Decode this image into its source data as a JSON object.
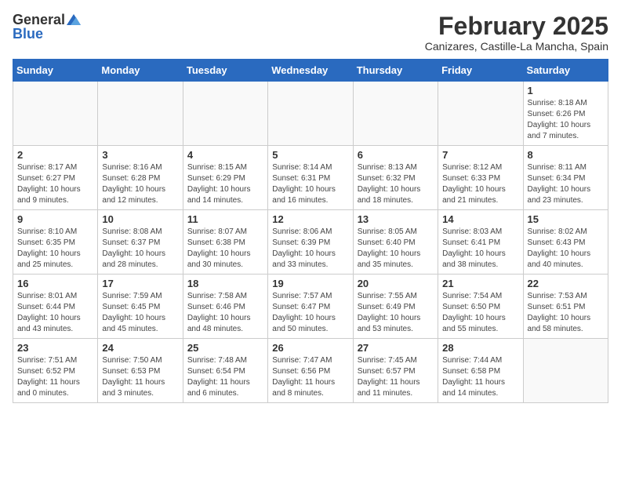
{
  "logo": {
    "general": "General",
    "blue": "Blue"
  },
  "title": "February 2025",
  "subtitle": "Canizares, Castille-La Mancha, Spain",
  "days_of_week": [
    "Sunday",
    "Monday",
    "Tuesday",
    "Wednesday",
    "Thursday",
    "Friday",
    "Saturday"
  ],
  "weeks": [
    [
      {
        "day": "",
        "info": ""
      },
      {
        "day": "",
        "info": ""
      },
      {
        "day": "",
        "info": ""
      },
      {
        "day": "",
        "info": ""
      },
      {
        "day": "",
        "info": ""
      },
      {
        "day": "",
        "info": ""
      },
      {
        "day": "1",
        "info": "Sunrise: 8:18 AM\nSunset: 6:26 PM\nDaylight: 10 hours\nand 7 minutes."
      }
    ],
    [
      {
        "day": "2",
        "info": "Sunrise: 8:17 AM\nSunset: 6:27 PM\nDaylight: 10 hours\nand 9 minutes."
      },
      {
        "day": "3",
        "info": "Sunrise: 8:16 AM\nSunset: 6:28 PM\nDaylight: 10 hours\nand 12 minutes."
      },
      {
        "day": "4",
        "info": "Sunrise: 8:15 AM\nSunset: 6:29 PM\nDaylight: 10 hours\nand 14 minutes."
      },
      {
        "day": "5",
        "info": "Sunrise: 8:14 AM\nSunset: 6:31 PM\nDaylight: 10 hours\nand 16 minutes."
      },
      {
        "day": "6",
        "info": "Sunrise: 8:13 AM\nSunset: 6:32 PM\nDaylight: 10 hours\nand 18 minutes."
      },
      {
        "day": "7",
        "info": "Sunrise: 8:12 AM\nSunset: 6:33 PM\nDaylight: 10 hours\nand 21 minutes."
      },
      {
        "day": "8",
        "info": "Sunrise: 8:11 AM\nSunset: 6:34 PM\nDaylight: 10 hours\nand 23 minutes."
      }
    ],
    [
      {
        "day": "9",
        "info": "Sunrise: 8:10 AM\nSunset: 6:35 PM\nDaylight: 10 hours\nand 25 minutes."
      },
      {
        "day": "10",
        "info": "Sunrise: 8:08 AM\nSunset: 6:37 PM\nDaylight: 10 hours\nand 28 minutes."
      },
      {
        "day": "11",
        "info": "Sunrise: 8:07 AM\nSunset: 6:38 PM\nDaylight: 10 hours\nand 30 minutes."
      },
      {
        "day": "12",
        "info": "Sunrise: 8:06 AM\nSunset: 6:39 PM\nDaylight: 10 hours\nand 33 minutes."
      },
      {
        "day": "13",
        "info": "Sunrise: 8:05 AM\nSunset: 6:40 PM\nDaylight: 10 hours\nand 35 minutes."
      },
      {
        "day": "14",
        "info": "Sunrise: 8:03 AM\nSunset: 6:41 PM\nDaylight: 10 hours\nand 38 minutes."
      },
      {
        "day": "15",
        "info": "Sunrise: 8:02 AM\nSunset: 6:43 PM\nDaylight: 10 hours\nand 40 minutes."
      }
    ],
    [
      {
        "day": "16",
        "info": "Sunrise: 8:01 AM\nSunset: 6:44 PM\nDaylight: 10 hours\nand 43 minutes."
      },
      {
        "day": "17",
        "info": "Sunrise: 7:59 AM\nSunset: 6:45 PM\nDaylight: 10 hours\nand 45 minutes."
      },
      {
        "day": "18",
        "info": "Sunrise: 7:58 AM\nSunset: 6:46 PM\nDaylight: 10 hours\nand 48 minutes."
      },
      {
        "day": "19",
        "info": "Sunrise: 7:57 AM\nSunset: 6:47 PM\nDaylight: 10 hours\nand 50 minutes."
      },
      {
        "day": "20",
        "info": "Sunrise: 7:55 AM\nSunset: 6:49 PM\nDaylight: 10 hours\nand 53 minutes."
      },
      {
        "day": "21",
        "info": "Sunrise: 7:54 AM\nSunset: 6:50 PM\nDaylight: 10 hours\nand 55 minutes."
      },
      {
        "day": "22",
        "info": "Sunrise: 7:53 AM\nSunset: 6:51 PM\nDaylight: 10 hours\nand 58 minutes."
      }
    ],
    [
      {
        "day": "23",
        "info": "Sunrise: 7:51 AM\nSunset: 6:52 PM\nDaylight: 11 hours\nand 0 minutes."
      },
      {
        "day": "24",
        "info": "Sunrise: 7:50 AM\nSunset: 6:53 PM\nDaylight: 11 hours\nand 3 minutes."
      },
      {
        "day": "25",
        "info": "Sunrise: 7:48 AM\nSunset: 6:54 PM\nDaylight: 11 hours\nand 6 minutes."
      },
      {
        "day": "26",
        "info": "Sunrise: 7:47 AM\nSunset: 6:56 PM\nDaylight: 11 hours\nand 8 minutes."
      },
      {
        "day": "27",
        "info": "Sunrise: 7:45 AM\nSunset: 6:57 PM\nDaylight: 11 hours\nand 11 minutes."
      },
      {
        "day": "28",
        "info": "Sunrise: 7:44 AM\nSunset: 6:58 PM\nDaylight: 11 hours\nand 14 minutes."
      },
      {
        "day": "",
        "info": ""
      }
    ]
  ]
}
